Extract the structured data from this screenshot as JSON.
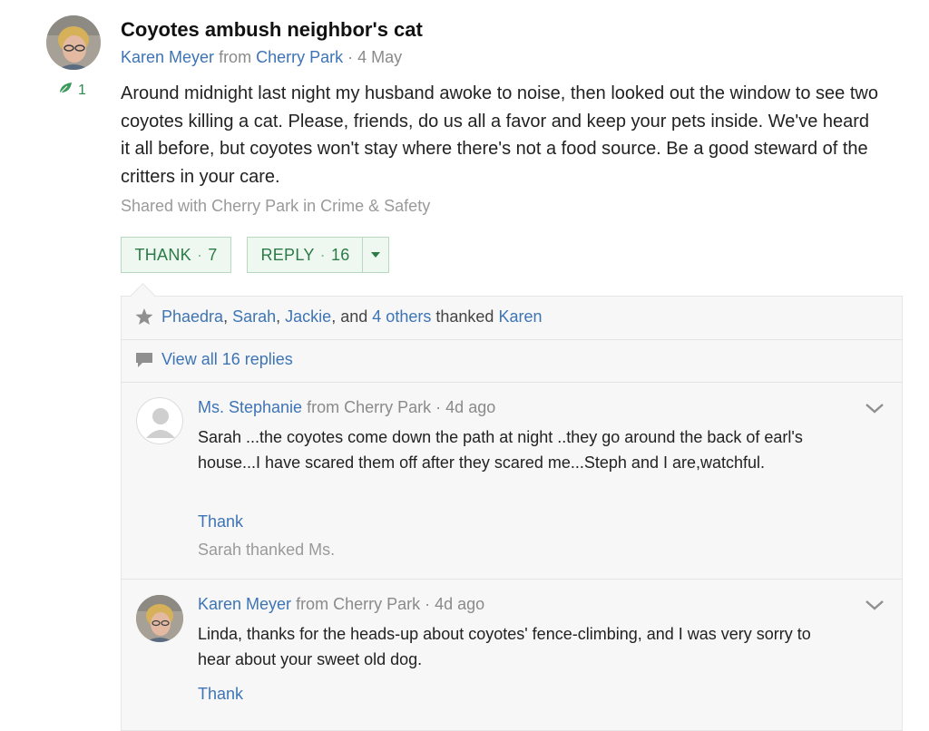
{
  "post": {
    "title": "Coyotes ambush neighbor's cat",
    "author": "Karen Meyer",
    "from_word": "from",
    "neighborhood": "Cherry Park",
    "date_sep": "·",
    "date": "4 May",
    "leaf_count": "1",
    "body": "Around midnight last night my husband awoke to noise, then looked out the window to see two coyotes killing a cat. Please, friends, do us all a favor and keep your pets inside. We've heard it all before, but coyotes won't stay where there's not a food source. Be a good steward of the critters in your care.",
    "shared_prefix": "Shared with",
    "shared_neighborhood": "Cherry Park",
    "shared_in": "in",
    "shared_category": "Crime & Safety"
  },
  "actions": {
    "thank_label": "THANK",
    "thank_count": "7",
    "reply_label": "REPLY",
    "reply_count": "16",
    "sep": "·"
  },
  "thanks": {
    "name1": "Phaedra",
    "name2": "Sarah",
    "name3": "Jackie",
    "and_word": "and",
    "others": "4 others",
    "thanked_word": "thanked",
    "target": "Karen",
    "comma": ","
  },
  "view_all": "View all 16 replies",
  "replies": [
    {
      "author": "Ms. Stephanie",
      "from_word": "from",
      "neighborhood": "Cherry Park",
      "sep": "·",
      "time": "4d ago",
      "text": "Sarah ...the coyotes come down the path at night ..they go around the back of earl's house...I have scared them off after they scared me...Steph and I are,watchful.",
      "thank_label": "Thank",
      "thanked_text": "Sarah thanked Ms."
    },
    {
      "author": "Karen Meyer",
      "from_word": "from",
      "neighborhood": "Cherry Park",
      "sep": "·",
      "time": "4d ago",
      "text": "Linda, thanks for the heads-up about coyotes' fence-climbing, and I was very sorry to hear about your sweet old dog.",
      "thank_label": "Thank"
    }
  ],
  "colors": {
    "link": "#3d74b5",
    "green": "#2b7a47",
    "muted": "#9a9a9a"
  },
  "icons": {
    "leaf": "leaf-icon",
    "star": "star-icon",
    "comment": "comment-icon",
    "chevron": "chevron-down-icon",
    "caret": "caret-down-icon"
  }
}
